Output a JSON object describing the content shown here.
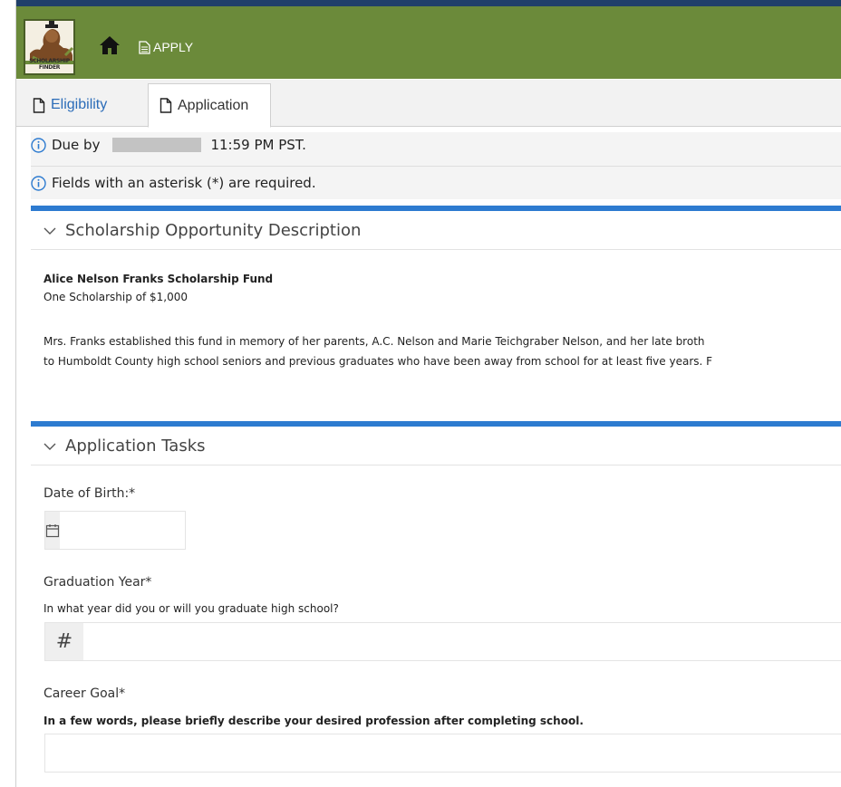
{
  "header": {
    "logo_text": "SCHOLARSHIP FINDER",
    "apply_label": "APPLY",
    "brand_color": "#6b8a3a",
    "accent_color": "#2d7bd0"
  },
  "tabs": [
    {
      "label": "Eligibility",
      "active": false,
      "icon": "file-icon"
    },
    {
      "label": "Application",
      "active": true,
      "icon": "file-icon"
    }
  ],
  "notices": {
    "due_prefix": "Due by",
    "due_suffix": "11:59 PM PST.",
    "required_note": "Fields with an asterisk (*) are required."
  },
  "description_panel": {
    "heading": "Scholarship Opportunity Description",
    "title": "Alice Nelson Franks Scholarship Fund",
    "subtitle": "One Scholarship of $1,000",
    "line1": "Mrs. Franks established this fund in memory of her parents, A.C. Nelson and Marie Teichgraber Nelson, and her late broth",
    "line2": "to Humboldt County high school seniors and previous graduates who have been away from school for at least five years. F"
  },
  "tasks_panel": {
    "heading": "Application Tasks",
    "dob": {
      "label": "Date of Birth:*",
      "value": ""
    },
    "grad_year": {
      "label": "Graduation Year*",
      "help": "In what year did you or will you graduate high school?",
      "addon": "#",
      "value": ""
    },
    "career_goal": {
      "label": "Career Goal*",
      "help": "In a few words, please briefly describe your desired profession after completing school.",
      "value": ""
    }
  }
}
